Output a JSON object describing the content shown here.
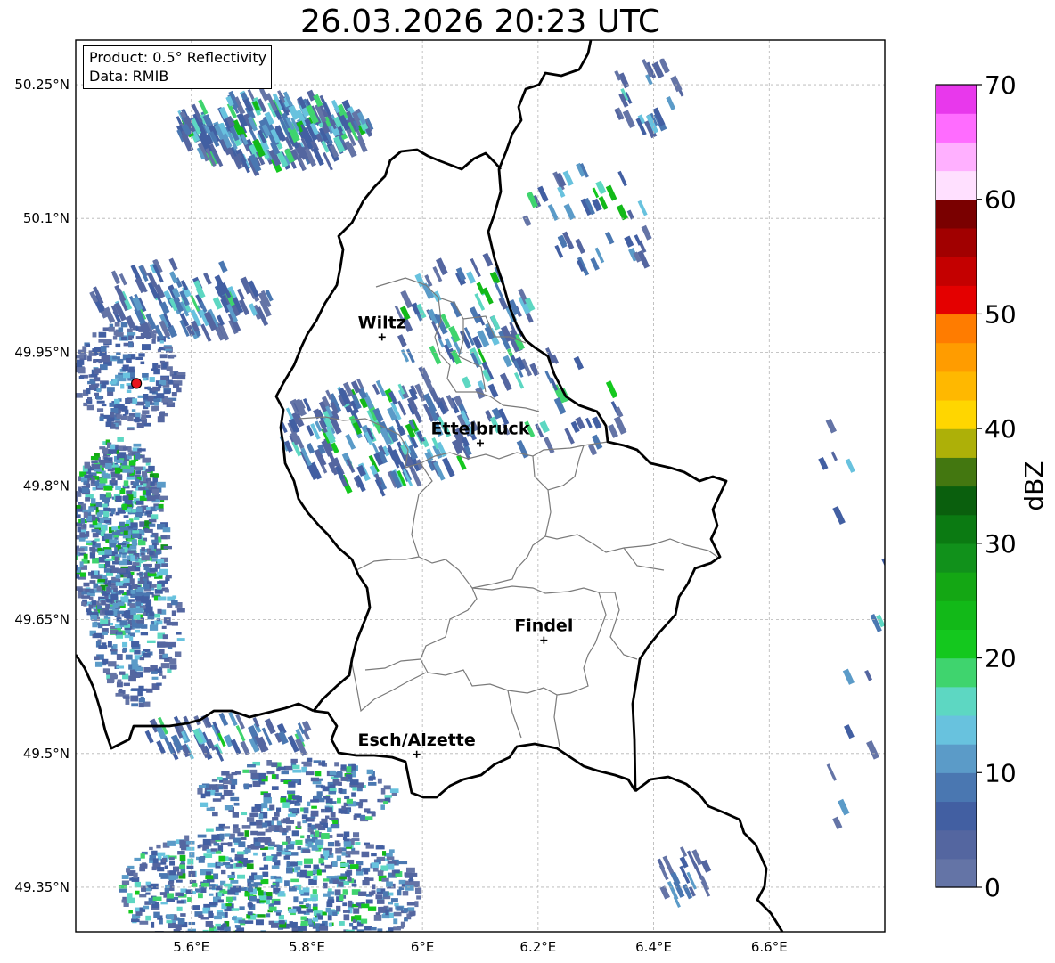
{
  "title": "26.03.2026 20:23 UTC",
  "info_box": {
    "product": "Product: 0.5° Reflectivity",
    "data": "Data: RMIB"
  },
  "map_extent": {
    "lon_min": 5.4,
    "lon_max": 6.8,
    "lat_min": 49.3,
    "lat_max": 50.3
  },
  "lon_ticks": [
    {
      "value": 5.6,
      "label": "5.6°E"
    },
    {
      "value": 5.8,
      "label": "5.8°E"
    },
    {
      "value": 6.0,
      "label": "6°E"
    },
    {
      "value": 6.2,
      "label": "6.2°E"
    },
    {
      "value": 6.4,
      "label": "6.4°E"
    },
    {
      "value": 6.6,
      "label": "6.6°E"
    }
  ],
  "lat_ticks": [
    {
      "value": 50.25,
      "label": "50.25°N"
    },
    {
      "value": 50.1,
      "label": "50.1°N"
    },
    {
      "value": 49.95,
      "label": "49.95°N"
    },
    {
      "value": 49.8,
      "label": "49.8°N"
    },
    {
      "value": 49.65,
      "label": "49.65°N"
    },
    {
      "value": 49.5,
      "label": "49.5°N"
    },
    {
      "value": 49.35,
      "label": "49.35°N"
    }
  ],
  "cities": [
    {
      "name": "Wiltz",
      "lon": 5.93,
      "lat": 49.967
    },
    {
      "name": "Ettelbruck",
      "lon": 6.1,
      "lat": 49.848
    },
    {
      "name": "Findel",
      "lon": 6.21,
      "lat": 49.627
    },
    {
      "name": "Esch/Alzette",
      "lon": 5.99,
      "lat": 49.499
    }
  ],
  "radar_site": {
    "lon": 5.505,
    "lat": 49.915,
    "color": "#e8141c"
  },
  "colorbar": {
    "label": "dBZ",
    "min": 0,
    "max": 70,
    "tick_values": [
      0,
      10,
      20,
      30,
      40,
      50,
      60,
      70
    ],
    "tick_labels": [
      "0",
      "10",
      "20",
      "30",
      "40",
      "50",
      "60",
      "70"
    ],
    "colors": [
      "#6474a6",
      "#5466a0",
      "#425fa2",
      "#4a77b1",
      "#5b9bc8",
      "#68c2de",
      "#5dd7c2",
      "#3fd46e",
      "#14c81e",
      "#12b918",
      "#14a714",
      "#11911b",
      "#0b7a12",
      "#0a5f0d",
      "#437710",
      "#adb008",
      "#ffd600",
      "#ffb800",
      "#ff9c00",
      "#ff7c00",
      "#e40000",
      "#c40000",
      "#a10000",
      "#7a0000",
      "#ffe0ff",
      "#ffb0ff",
      "#ff6cff",
      "#e838ec"
    ]
  },
  "colors": {
    "border": "#000000",
    "canton": "#7a7a7a",
    "grid": "#b4b4b4"
  }
}
